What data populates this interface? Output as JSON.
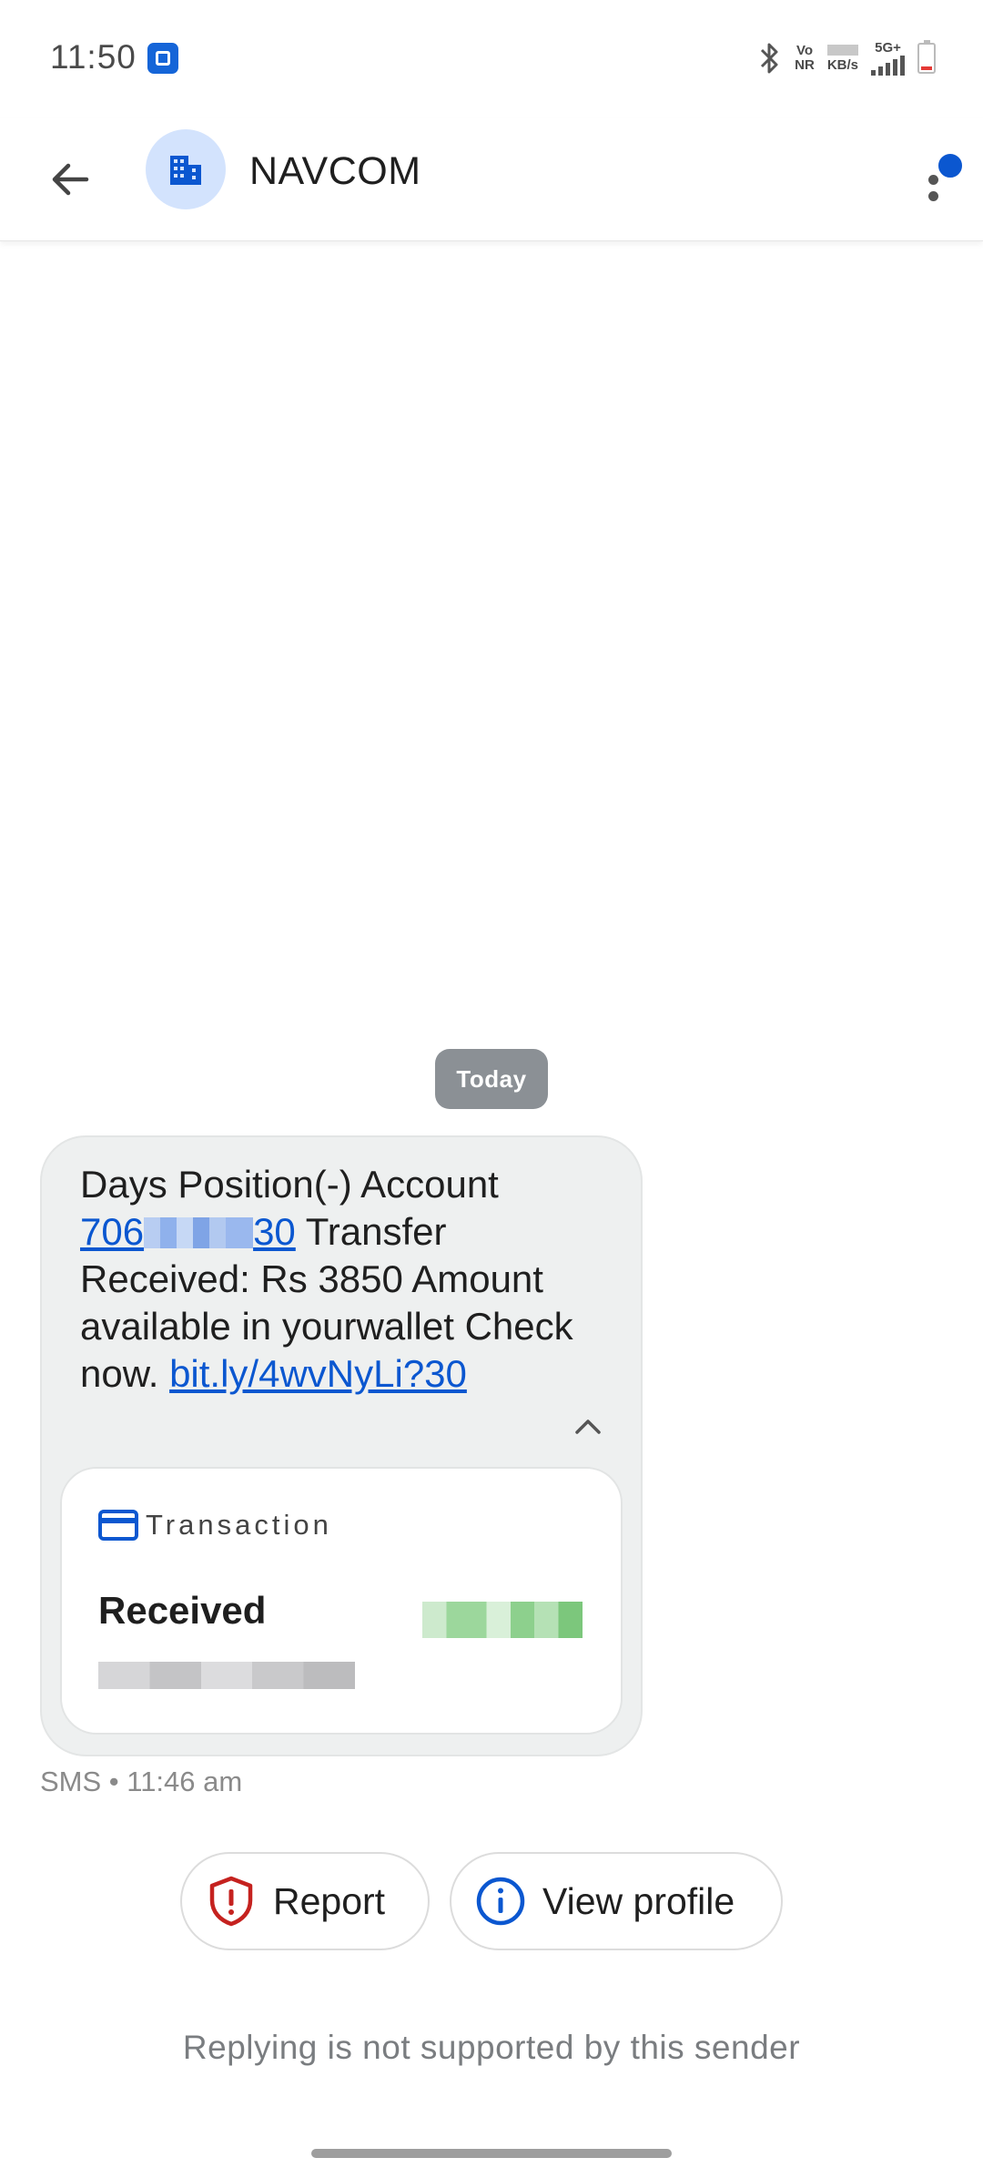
{
  "status_bar": {
    "time": "11:50",
    "vo_top": "Vo",
    "vo_bottom": "NR",
    "speed_unit": "KB/s",
    "network": "5G+",
    "icons": [
      "app-notification-icon",
      "bluetooth-icon",
      "signal-icon",
      "battery-icon"
    ]
  },
  "app_bar": {
    "sender": "NAVCOM",
    "avatar_icon": "business-building-icon",
    "accent": "#0b57d0"
  },
  "conversation": {
    "date_chip": "Today",
    "message": {
      "line1": "Days Position(-) Account",
      "account_prefix": "706",
      "account_suffix": "30",
      "after_account": " Transfer Received: Rs 3850 Amount available in yourwallet Check now. ",
      "link": "bit.ly/4wvNyLi?30",
      "meta": "SMS • 11:46 am"
    },
    "transaction_card": {
      "label": "Transaction",
      "status": "Received"
    }
  },
  "actions": {
    "report": "Report",
    "view_profile": "View profile"
  },
  "footer": {
    "reply_note": "Replying is not supported by this sender"
  },
  "colors": {
    "bubble": "#eef0f0",
    "chip": "#8b9095",
    "link": "#0b57d0",
    "report_icon": "#c5221f"
  }
}
